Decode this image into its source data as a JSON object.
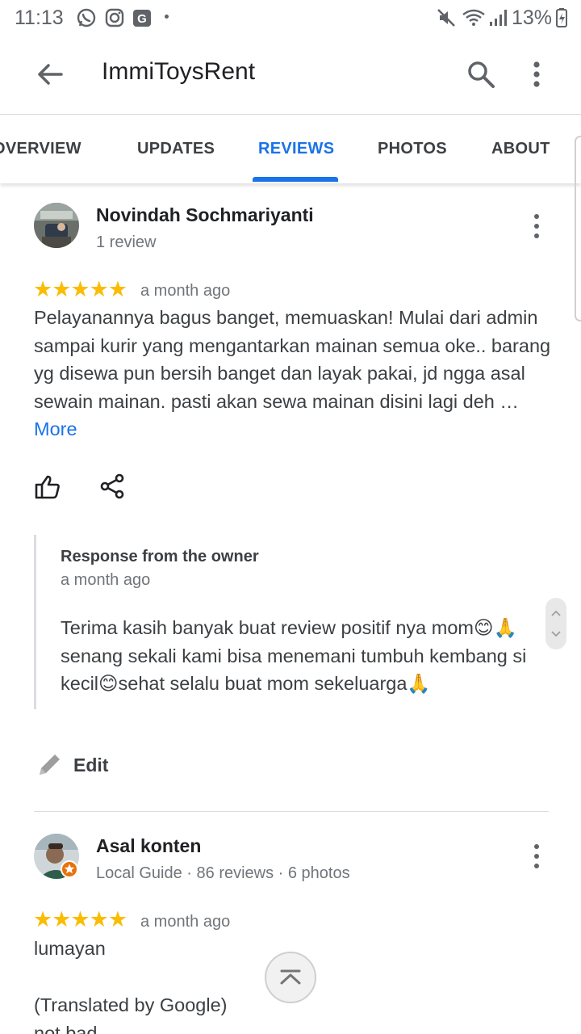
{
  "status_bar": {
    "time": "11:13",
    "battery": "13%",
    "left_icons": [
      "whatsapp-icon",
      "instagram-icon",
      "google-icon"
    ],
    "right_icons": [
      "mute-icon",
      "wifi-icon",
      "signal-icon",
      "battery-icon"
    ]
  },
  "app_bar": {
    "title": "ImmiToysRent"
  },
  "tabs": [
    {
      "label": "OVERVIEW",
      "active": false
    },
    {
      "label": "UPDATES",
      "active": false
    },
    {
      "label": "REVIEWS",
      "active": true
    },
    {
      "label": "PHOTOS",
      "active": false
    },
    {
      "label": "ABOUT",
      "active": false
    }
  ],
  "colors": {
    "accent": "#1a73e8",
    "star": "#fbbc04",
    "text_secondary": "#70757a"
  },
  "reviews": [
    {
      "name": "Novindah Sochmariyanti",
      "meta": "1 review",
      "rating": 5,
      "stars": "★★★★★",
      "date": "a month ago",
      "text": "Pelayanannya bagus banget, memuaskan! Mulai dari admin sampai kurir yang mengantarkan mainan semua oke.. barang yg disewa pun bersih banget dan layak pakai, jd ngga asal sewain mainan. pasti akan sewa mainan disini lagi deh …",
      "more_label": "More",
      "owner_response": {
        "title": "Response from the owner",
        "date": "a month ago",
        "text": "Terima kasih banyak buat review positif nya mom😊🙏 senang sekali kami bisa menemani tumbuh kembang si kecil😊sehat selalu buat mom sekeluarga🙏"
      },
      "edit_label": "Edit"
    },
    {
      "name": "Asal konten",
      "meta": "Local Guide · 86 reviews · 6 photos",
      "rating": 5,
      "stars": "★★★★★",
      "date": "a month ago",
      "text": "lumayan",
      "translated_label": "(Translated by Google)",
      "translated_text": "not bad"
    }
  ]
}
